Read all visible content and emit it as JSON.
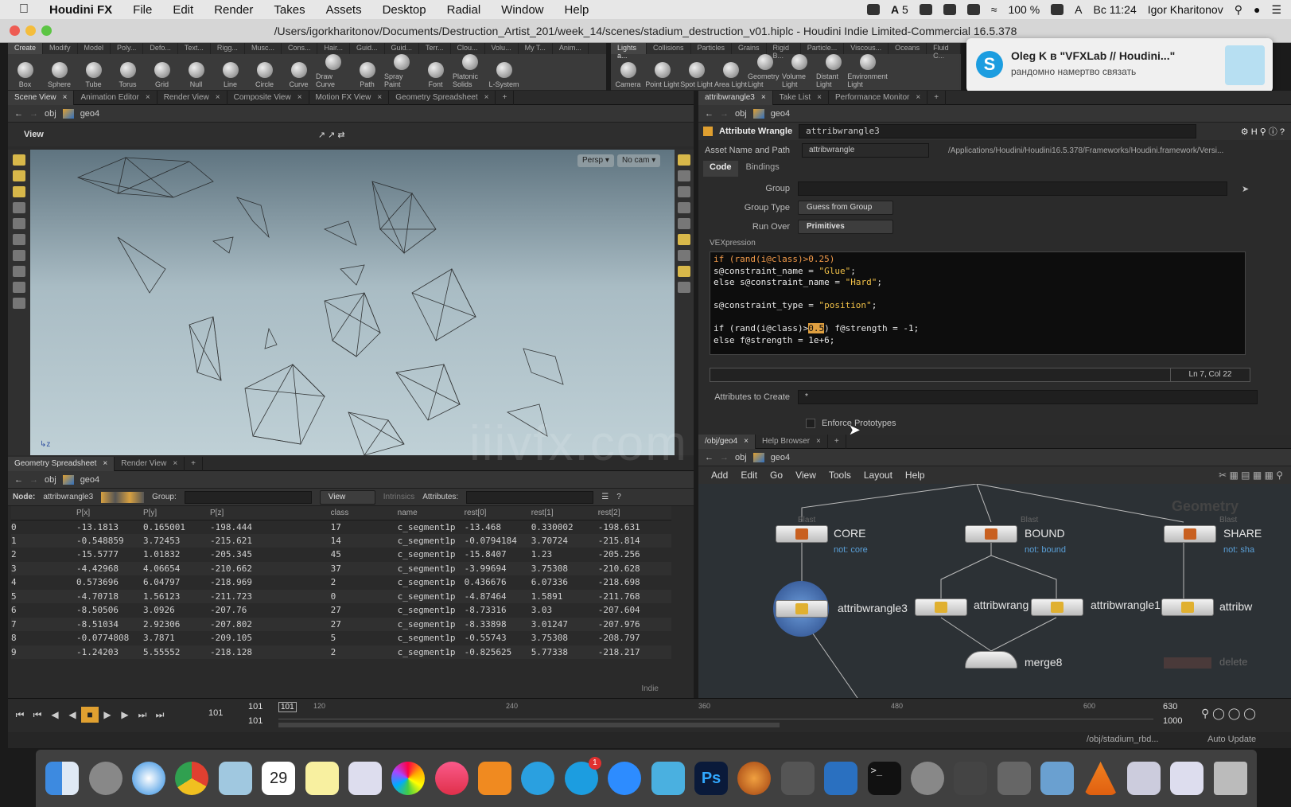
{
  "menubar": {
    "app_name": "Houdini FX",
    "items": [
      "File",
      "Edit",
      "Render",
      "Takes",
      "Assets",
      "Desktop",
      "Radial",
      "Window",
      "Help"
    ],
    "status": [
      "5",
      "100 %",
      "Вс 11:24",
      "Igor Kharitonov"
    ]
  },
  "window": {
    "title": "/Users/igorkharitonov/Documents/Destruction_Artist_201/week_14/scenes/stadium_destruction_v01.hiplc - Houdini Indie Limited-Commercial 16.5.378"
  },
  "shelf_left": {
    "tabs": [
      "Create",
      "Modify",
      "Model",
      "Poly...",
      "Defo...",
      "Text...",
      "Rigg...",
      "Musc...",
      "Cons...",
      "Hair...",
      "Guid...",
      "Guid...",
      "Terr...",
      "Clou...",
      "Volu...",
      "My T...",
      "Anim..."
    ],
    "tools": [
      "Box",
      "Sphere",
      "Tube",
      "Torus",
      "Grid",
      "Null",
      "Line",
      "Circle",
      "Curve",
      "Draw Curve",
      "Path",
      "Spray Paint",
      "Font",
      "Platonic Solids",
      "L-System"
    ]
  },
  "shelf_right": {
    "tabs": [
      "Lights a...",
      "Collisions",
      "Particles",
      "Grains",
      "Rigid B...",
      "Particle...",
      "Viscous...",
      "Oceans",
      "Fluid C..."
    ],
    "tools": [
      "Camera",
      "Point Light",
      "Spot Light",
      "Area Light",
      "Geometry Light",
      "Volume Light",
      "Distant Light",
      "Environment Light"
    ]
  },
  "notification": {
    "title": "Oleg K в \"VFXLab // Houdini...\"",
    "body": "рандомно намертво связать"
  },
  "left_tabs": [
    "Scene View",
    "Animation Editor",
    "Render View",
    "Composite View",
    "Motion FX View",
    "Geometry Spreadsheet"
  ],
  "path": {
    "obj": "obj",
    "geo": "geo4"
  },
  "viewport": {
    "label": "View",
    "persp": "Persp",
    "cam": "No cam"
  },
  "spreadsheet": {
    "tabs": [
      "Geometry Spreadsheet",
      "Render View"
    ],
    "node_label": "Node:",
    "node_name": "attribwrangle3",
    "group_label": "Group:",
    "view_label": "View",
    "intrinsics_label": "Intrinsics",
    "attributes_label": "Attributes:",
    "columns": [
      "",
      "P[x]",
      "P[y]",
      "P[z]",
      "class",
      "name",
      "rest[0]",
      "rest[1]",
      "rest[2]"
    ],
    "rows": [
      [
        "0",
        "-13.1813",
        "0.165001",
        "-198.444",
        "17",
        "c_segment1p",
        "-13.468",
        "0.330002",
        "-198.631"
      ],
      [
        "1",
        "-0.548859",
        "3.72453",
        "-215.621",
        "14",
        "c_segment1p",
        "-0.0794184",
        "3.70724",
        "-215.814"
      ],
      [
        "2",
        "-15.5777",
        "1.01832",
        "-205.345",
        "45",
        "c_segment1p",
        "-15.8407",
        "1.23",
        "-205.256"
      ],
      [
        "3",
        "-4.42968",
        "4.06654",
        "-210.662",
        "37",
        "c_segment1p",
        "-3.99694",
        "3.75308",
        "-210.628"
      ],
      [
        "4",
        "0.573696",
        "6.04797",
        "-218.969",
        "2",
        "c_segment1p",
        "0.436676",
        "6.07336",
        "-218.698"
      ],
      [
        "5",
        "-4.70718",
        "1.56123",
        "-211.723",
        "0",
        "c_segment1p",
        "-4.87464",
        "1.5891",
        "-211.768"
      ],
      [
        "6",
        "-8.50506",
        "3.0926",
        "-207.76",
        "27",
        "c_segment1p",
        "-8.73316",
        "3.03",
        "-207.604"
      ],
      [
        "7",
        "-8.51034",
        "2.92306",
        "-207.802",
        "27",
        "c_segment1p",
        "-8.33898",
        "3.01247",
        "-207.976"
      ],
      [
        "8",
        "-0.0774808",
        "3.7871",
        "-209.105",
        "5",
        "c_segment1p",
        "-0.55743",
        "3.75308",
        "-208.797"
      ],
      [
        "9",
        "-1.24203",
        "5.55552",
        "-218.128",
        "2",
        "c_segment1p",
        "-0.825625",
        "5.77338",
        "-218.217"
      ]
    ],
    "indie": "Indie"
  },
  "timeline": {
    "current_frame": "101",
    "start_frame": "101",
    "end_frame_a": "101",
    "ticks": [
      "101",
      "120",
      "240",
      "360",
      "480",
      "600",
      "630"
    ],
    "range_end": "1000"
  },
  "right_tabs_top": [
    "attribwrangle3",
    "Take List",
    "Performance Monitor"
  ],
  "parameters": {
    "node_type": "Attribute Wrangle",
    "node_name": "attribwrangle3",
    "asset_label": "Asset Name and Path",
    "asset_name": "attribwrangle",
    "asset_path": "/Applications/Houdini/Houdini16.5.378/Frameworks/Houdini.framework/Versi...",
    "tabs": [
      "Code",
      "Bindings"
    ],
    "group_label": "Group",
    "group_type_label": "Group Type",
    "group_type_value": "Guess from Group",
    "run_over_label": "Run Over",
    "run_over_value": "Primitives",
    "vex_label": "VEXpression",
    "cursor_pos": "Ln 7, Col 22",
    "attrs_label": "Attributes to Create",
    "attrs_value": "*",
    "enforce_label": "Enforce Prototypes"
  },
  "code": {
    "l1a": "if (rand(i@class)>0.25)",
    "l2a": "s@constraint_name = ",
    "l2b": "\"Glue\"",
    "l2c": ";",
    "l3a": "else s@constraint_name = ",
    "l3b": "\"Hard\"",
    "l3c": ";",
    "l5a": "s@constraint_type = ",
    "l5b": "\"position\"",
    "l5c": ";",
    "l7a": "if (rand(i@class)>",
    "l7b": "0.5",
    "l7c": ") f@strength = -1;",
    "l8a": "else f@strength = 1e+6;"
  },
  "network": {
    "tabs": [
      "/obj/geo4",
      "Help Browser"
    ],
    "menu": [
      "Add",
      "Edit",
      "Go",
      "View",
      "Tools",
      "Layout",
      "Help"
    ],
    "context_label": "Geometry",
    "nodes": [
      {
        "type": "Blast",
        "name": "CORE",
        "sub": "not: core"
      },
      {
        "type": "Blast",
        "name": "BOUND",
        "sub": "not: bound"
      },
      {
        "type": "Blast",
        "name": "SHARE",
        "sub": "not: sha"
      }
    ],
    "wrangles": [
      "attribwrangle3",
      "attribwrang",
      "attribwrangle1",
      "attribw"
    ],
    "merge": "merge8",
    "bottom_right": "delete"
  },
  "status_bar": {
    "path": "/obj/stadium_rbd...",
    "update": "Auto Update"
  },
  "watermark": "iiivfx.com",
  "dock_badge": "1",
  "calendar_day": "29"
}
